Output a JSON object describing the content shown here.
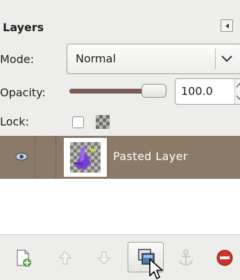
{
  "dock": {
    "title": "Layers",
    "config_icon": "tab-menu-icon"
  },
  "mode": {
    "label": "Mode:",
    "value": "Normal"
  },
  "opacity": {
    "label": "Opacity:",
    "value": "100.0",
    "level": 1.0
  },
  "lock": {
    "label": "Lock:",
    "pixels_checked": false
  },
  "layers": [
    {
      "name": "Pasted Layer",
      "visible": true,
      "selected": true
    }
  ],
  "toolbar": {
    "buttons": [
      "new-layer-icon",
      "raise-layer-icon",
      "lower-layer-icon",
      "duplicate-layer-icon",
      "anchor-layer-icon",
      "delete-layer-icon"
    ],
    "active": "duplicate-layer-icon"
  },
  "colors": {
    "selected_row": "#8c7a68",
    "slider_fill": "#7a5d52",
    "delete": "#d0312d",
    "new_layer": "#5aa34a"
  }
}
